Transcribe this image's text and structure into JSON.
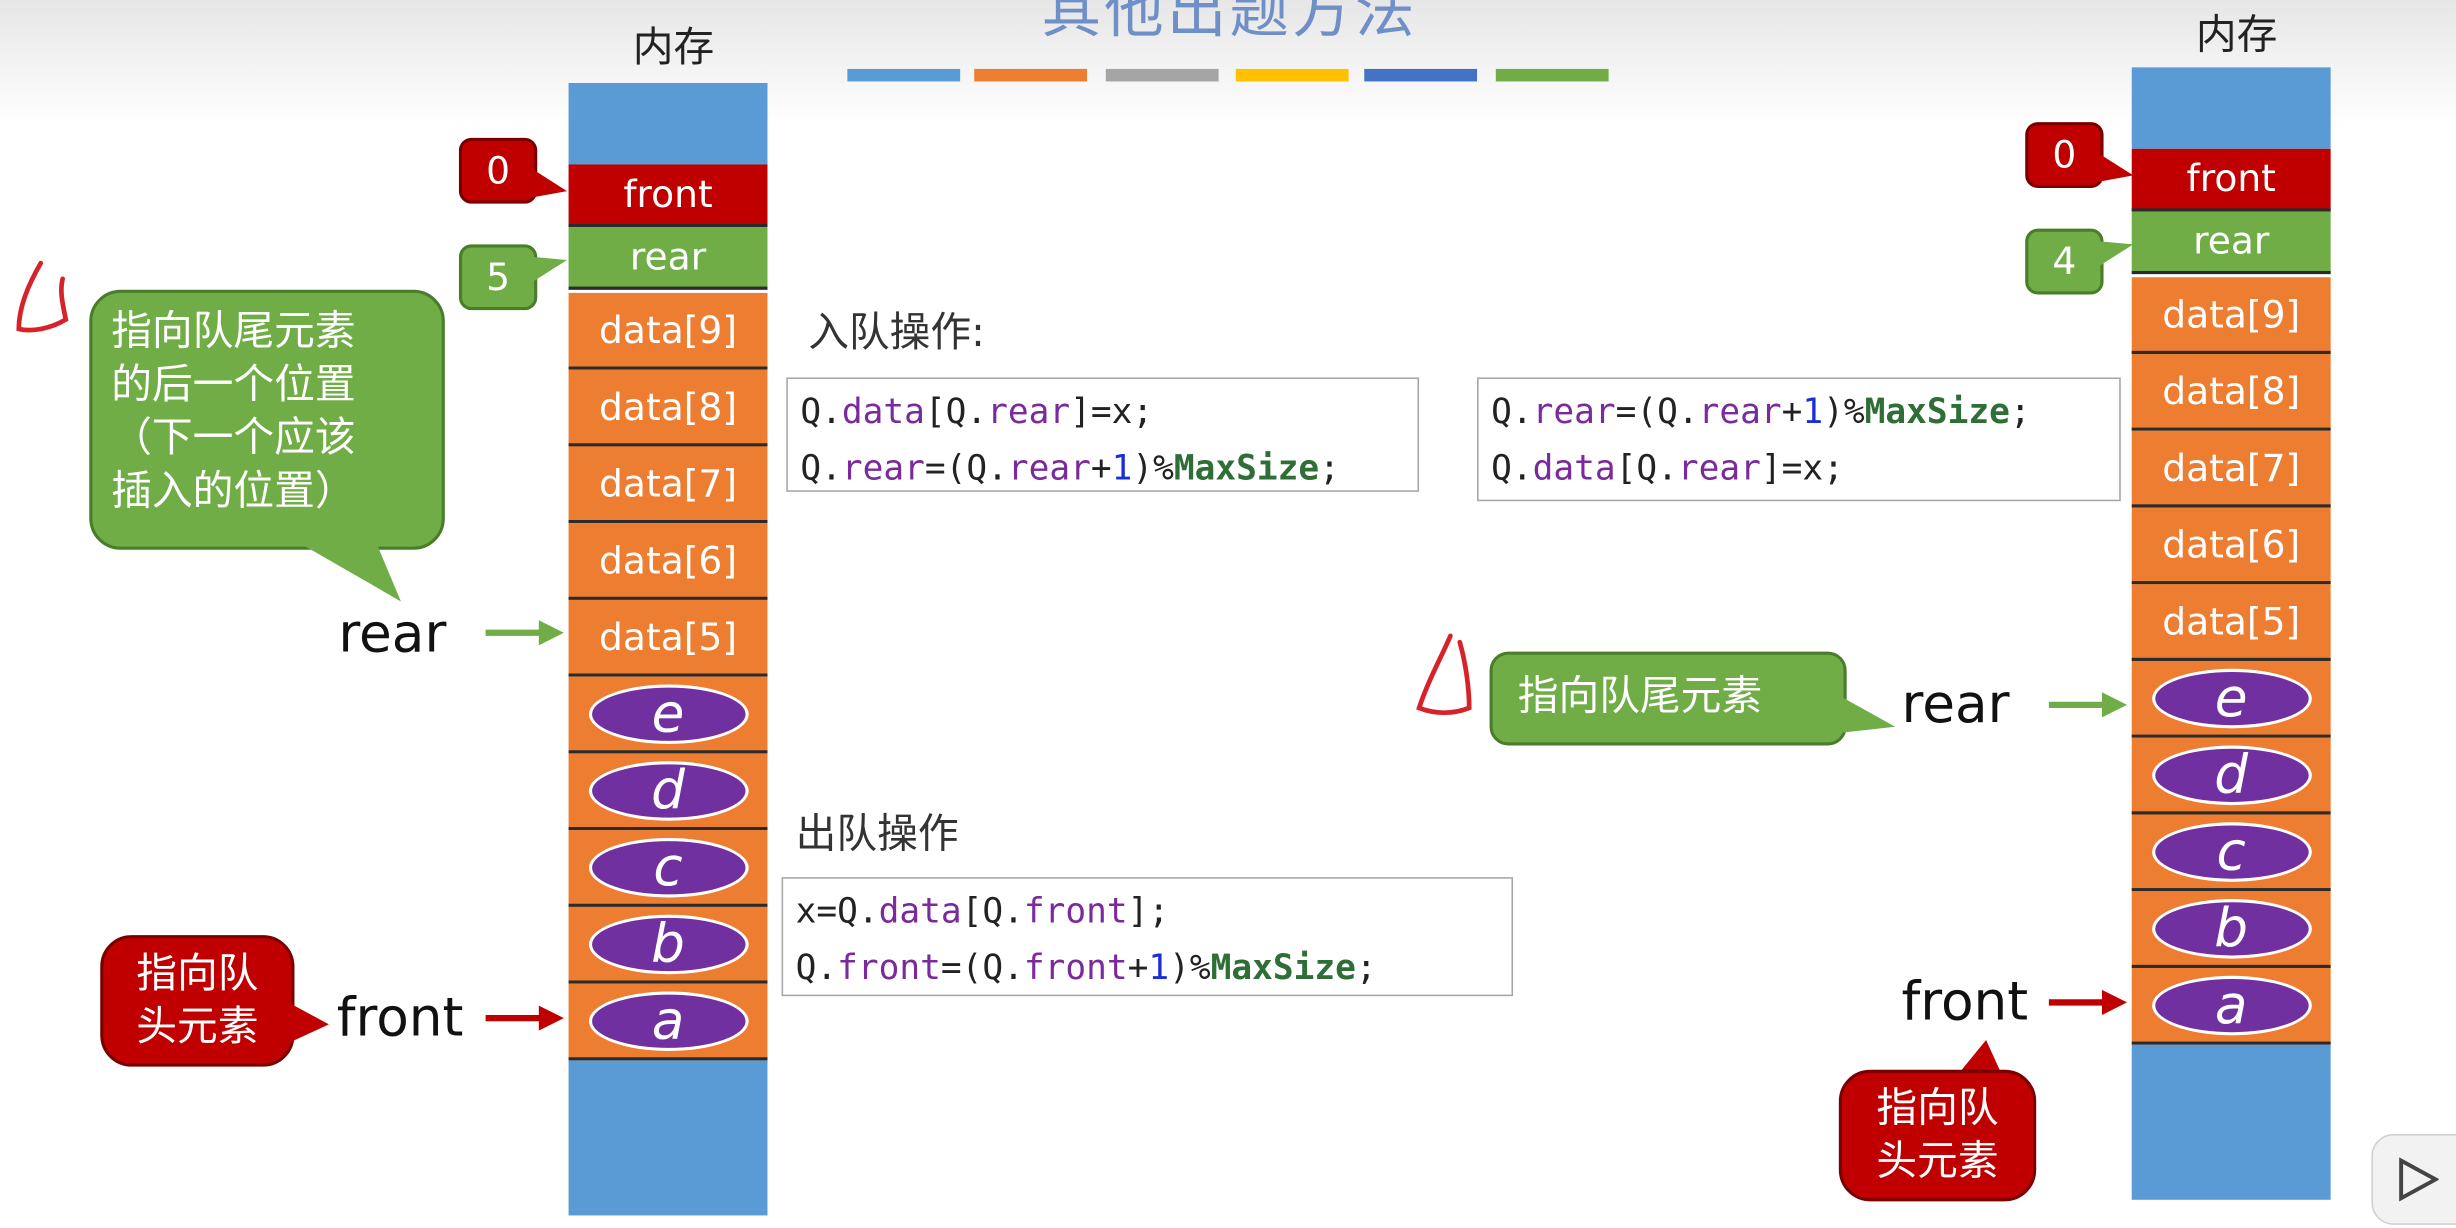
{
  "slide": {
    "title": "其他出题方法",
    "strip_colors": [
      "#5b9bd5",
      "#ed7d31",
      "#a5a5a5",
      "#ffc000",
      "#4472c4",
      "#70ad47"
    ]
  },
  "left": {
    "memory_label": "内存",
    "front_cell": "front",
    "rear_cell": "rear",
    "front_value": "0",
    "rear_value": "5",
    "data_cells": [
      "data[9]",
      "data[8]",
      "data[7]",
      "data[6]",
      "data[5]"
    ],
    "elements": [
      "e",
      "d",
      "c",
      "b",
      "a"
    ],
    "rear_callout": [
      "指向队尾元素",
      "的后一个位置",
      "（下一个应该",
      "插入的位置）"
    ],
    "front_callout": [
      "指向队",
      "头元素"
    ],
    "rear_label": "rear",
    "front_label": "front"
  },
  "right": {
    "memory_label": "内存",
    "front_cell": "front",
    "rear_cell": "rear",
    "front_value": "0",
    "rear_value": "4",
    "data_cells": [
      "data[9]",
      "data[8]",
      "data[7]",
      "data[6]",
      "data[5]"
    ],
    "elements": [
      "e",
      "d",
      "c",
      "b",
      "a"
    ],
    "rear_callout": "指向队尾元素",
    "front_callout": [
      "指向队",
      "头元素"
    ],
    "rear_label": "rear",
    "front_label": "front"
  },
  "ops": {
    "enqueue_label": "入队操作:",
    "dequeue_label": "出队操作"
  },
  "colors": {
    "front_red": "#c00000",
    "rear_green": "#70ad47",
    "cell_orange": "#ed7d31",
    "mem_blue": "#5b9bd5",
    "element_purple": "#7030a0"
  },
  "icons": {
    "play": "play-icon"
  }
}
